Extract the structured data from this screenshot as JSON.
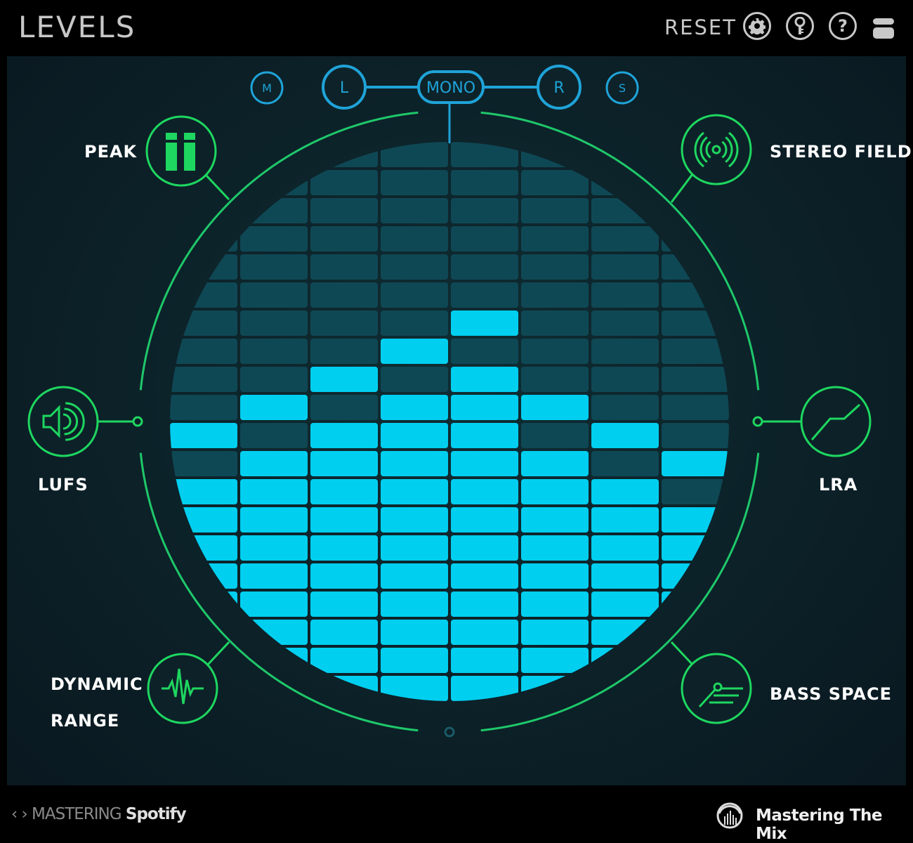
{
  "header": {
    "title": "LEVELS",
    "reset_label": "RESET",
    "icons": [
      "gear-icon",
      "key-icon",
      "help-icon",
      "layout-icon"
    ],
    "help_glyph": "?"
  },
  "channels": [
    {
      "label": "M",
      "active": false
    },
    {
      "label": "L",
      "active": true
    },
    {
      "label": "MONO",
      "active": true,
      "selected": true
    },
    {
      "label": "R",
      "active": true
    },
    {
      "label": "S",
      "active": false
    }
  ],
  "modules": {
    "peak": "PEAK",
    "stereo_field": "STEREO FIELD",
    "lufs": "LUFS",
    "lra": "LRA",
    "dynamic_range_line1": "DYNAMIC",
    "dynamic_range_line2": "RANGE",
    "bass_space": "BASS SPACE"
  },
  "meter": {
    "rows": 20,
    "columns": [
      {
        "peak_row": 10,
        "fill_from_row": 12
      },
      {
        "peak_row": 9,
        "fill_from_row": 11
      },
      {
        "peak_row": 8,
        "fill_from_row": 10
      },
      {
        "peak_row": 7,
        "fill_from_row": 9
      },
      {
        "peak_row": 6,
        "fill_from_row": 8
      },
      {
        "peak_row": 9,
        "fill_from_row": 11
      },
      {
        "peak_row": 10,
        "fill_from_row": 12
      },
      {
        "peak_row": 11,
        "fill_from_row": 13
      }
    ]
  },
  "colors": {
    "accent_green": "#1ed760",
    "channel_blue": "#1fa3d8",
    "lit_cell": "#00cff0",
    "dark_cell": "#0f4855"
  },
  "footer": {
    "nav_glyph": "‹ ›",
    "product_prefix": "MASTERING",
    "product_name": "Spotify",
    "brand": "Mastering The Mix"
  }
}
